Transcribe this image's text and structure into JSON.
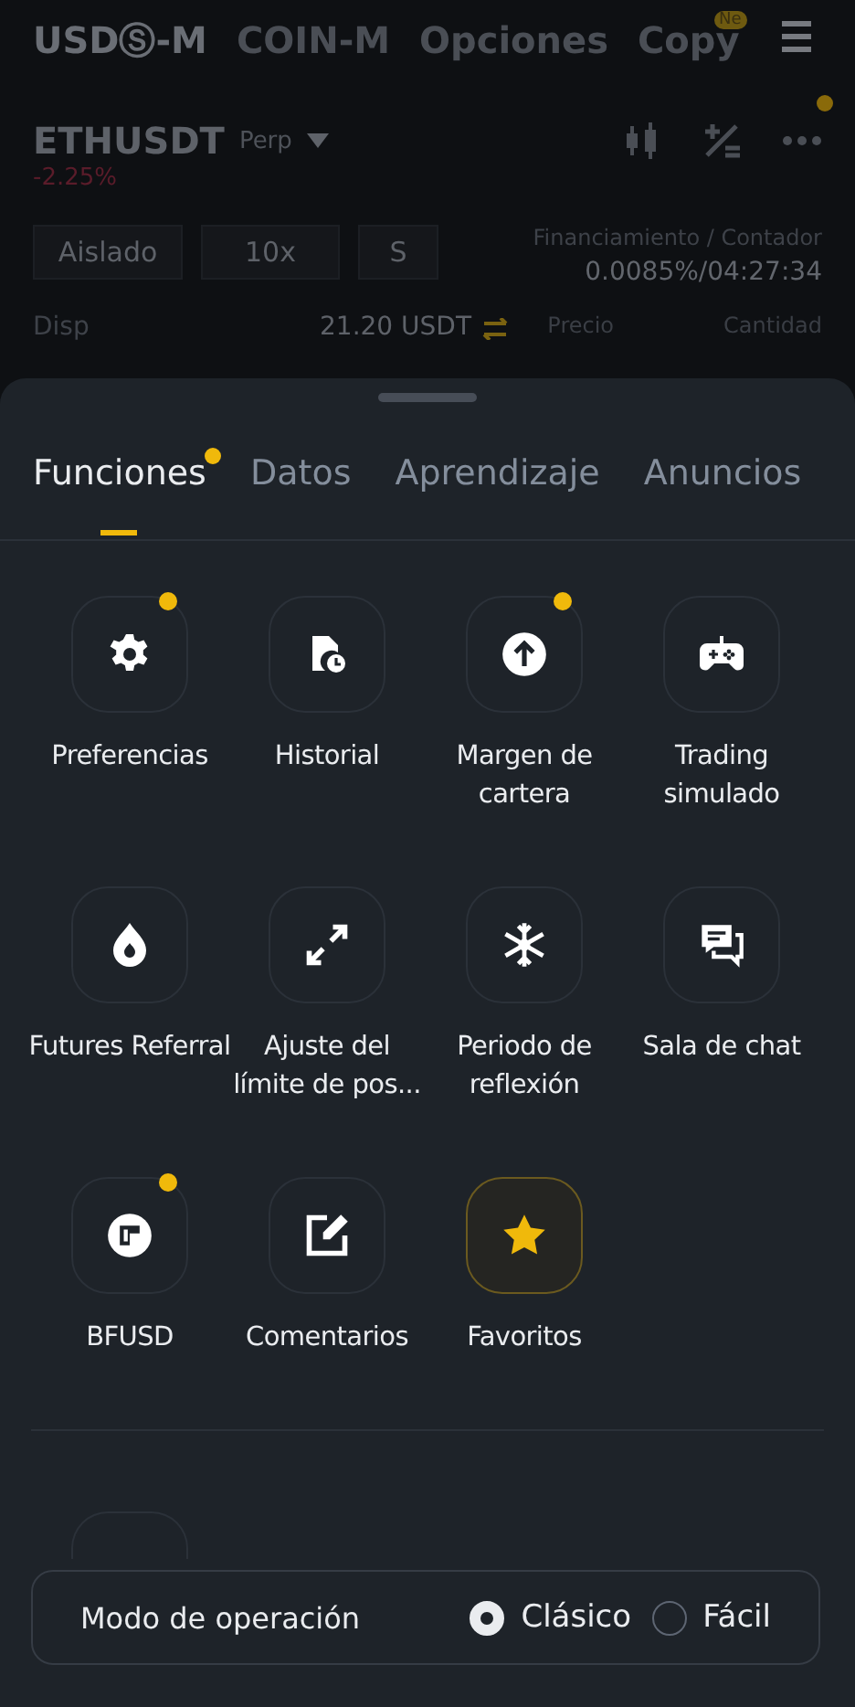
{
  "market_tabs": [
    {
      "label": "USDⓈ-M",
      "selected": true
    },
    {
      "label": "COIN-M",
      "selected": false
    },
    {
      "label": "Opciones",
      "selected": false
    },
    {
      "label": "Copy",
      "selected": false,
      "badge": "Ne"
    }
  ],
  "symbol": {
    "name": "ETHUSDT",
    "type": "Perp",
    "change": "-2.25%"
  },
  "order_settings": [
    "Aislado",
    "10x",
    "S"
  ],
  "funding": {
    "label": "Financiamiento / Contador",
    "value": "0.0085%/04:27:34"
  },
  "available": {
    "label": "Disp",
    "value": "21.20 USDT"
  },
  "book_headers": [
    "Precio",
    "Cantidad"
  ],
  "sheet_tabs": [
    {
      "label": "Funciones",
      "selected": true,
      "dot": true
    },
    {
      "label": "Datos",
      "selected": false,
      "dot": false
    },
    {
      "label": "Aprendizaje",
      "selected": false,
      "dot": false
    },
    {
      "label": "Anuncios",
      "selected": false,
      "dot": false
    }
  ],
  "tiles": [
    {
      "label": "Preferencias",
      "dot": true,
      "highlighted": false
    },
    {
      "label": "Historial",
      "dot": false,
      "highlighted": false
    },
    {
      "label": "Margen de cartera",
      "dot": true,
      "highlighted": false
    },
    {
      "label": "Trading simulado",
      "dot": false,
      "highlighted": false
    },
    {
      "label": "Futures Referral",
      "dot": false,
      "highlighted": false
    },
    {
      "label": "Ajuste del límite de pos...",
      "dot": false,
      "highlighted": false
    },
    {
      "label": "Periodo de reflexión",
      "dot": false,
      "highlighted": false
    },
    {
      "label": "Sala de chat",
      "dot": false,
      "highlighted": false
    },
    {
      "label": "BFUSD",
      "dot": true,
      "highlighted": false
    },
    {
      "label": "Comentarios",
      "dot": false,
      "highlighted": false
    },
    {
      "label": "Favoritos",
      "dot": false,
      "highlighted": true
    }
  ],
  "mode": {
    "label": "Modo de operación",
    "options": [
      {
        "label": "Clásico",
        "selected": true
      },
      {
        "label": "Fácil",
        "selected": false
      }
    ]
  }
}
